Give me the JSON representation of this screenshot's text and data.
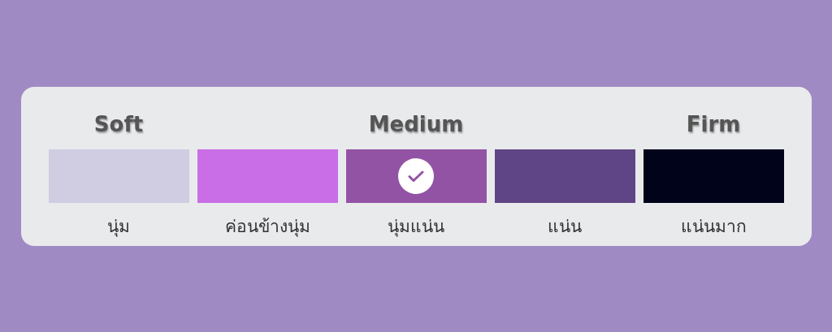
{
  "options": [
    {
      "heading": "Soft",
      "label": "นุ่ม",
      "color": "#d0cce2",
      "selected": false
    },
    {
      "label": "ค่อนข้างนุ่ม",
      "color": "#c96ee6",
      "selected": false
    },
    {
      "heading": "Medium",
      "label": "นุ่มแน่น",
      "color": "#9353a5",
      "selected": true
    },
    {
      "label": "แน่น",
      "color": "#5f4585",
      "selected": false
    },
    {
      "heading": "Firm",
      "label": "แน่นมาก",
      "color": "#00031a",
      "selected": false
    }
  ]
}
